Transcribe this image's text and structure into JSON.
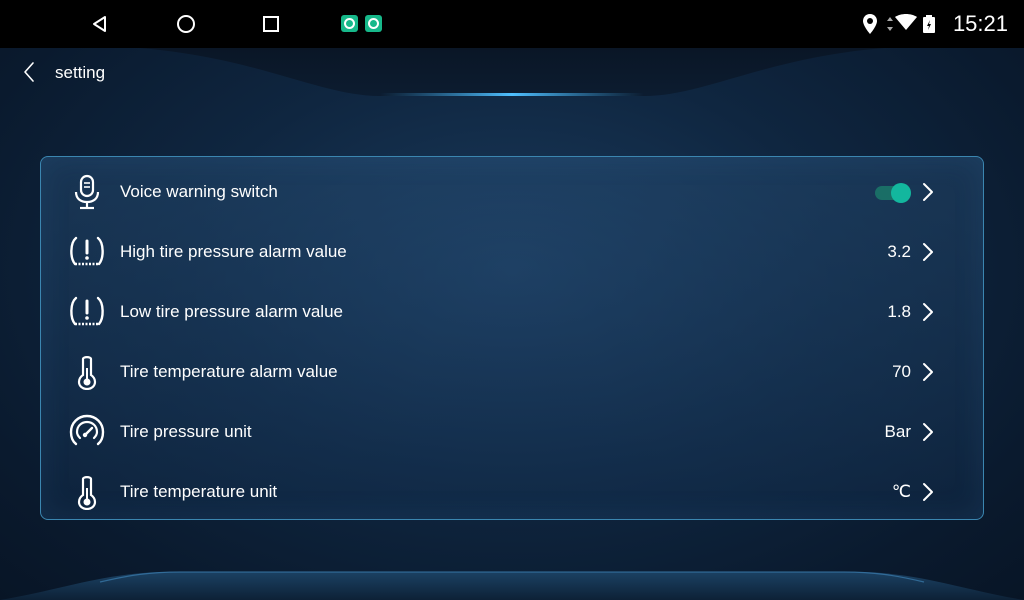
{
  "statusbar": {
    "time": "15:21",
    "nav_icons": [
      "back-triangle-icon",
      "home-circle-icon",
      "recents-square-icon"
    ],
    "app_icons": [
      "camera-app-icon",
      "camera-app-icon"
    ],
    "status_icons": [
      "location-icon",
      "data-arrows-icon",
      "wifi-icon",
      "battery-icon"
    ]
  },
  "header": {
    "title": "setting"
  },
  "settings": {
    "items": [
      {
        "label": "Voice warning switch",
        "value": "",
        "icon": "microphone-icon",
        "toggle": true
      },
      {
        "label": "High tire pressure alarm value",
        "value": "3.2",
        "icon": "tire-pressure-warning-icon"
      },
      {
        "label": "Low tire pressure alarm value",
        "value": "1.8",
        "icon": "tire-pressure-warning-icon"
      },
      {
        "label": "Tire temperature alarm value",
        "value": "70",
        "icon": "thermometer-icon"
      },
      {
        "label": "Tire pressure unit",
        "value": "Bar",
        "icon": "gauge-icon"
      },
      {
        "label": "Tire temperature unit",
        "value": "℃",
        "icon": "thermometer-icon"
      }
    ]
  },
  "colors": {
    "accent": "#13b79e",
    "panel_border": "#3b86b0",
    "background": "#0f2640"
  }
}
